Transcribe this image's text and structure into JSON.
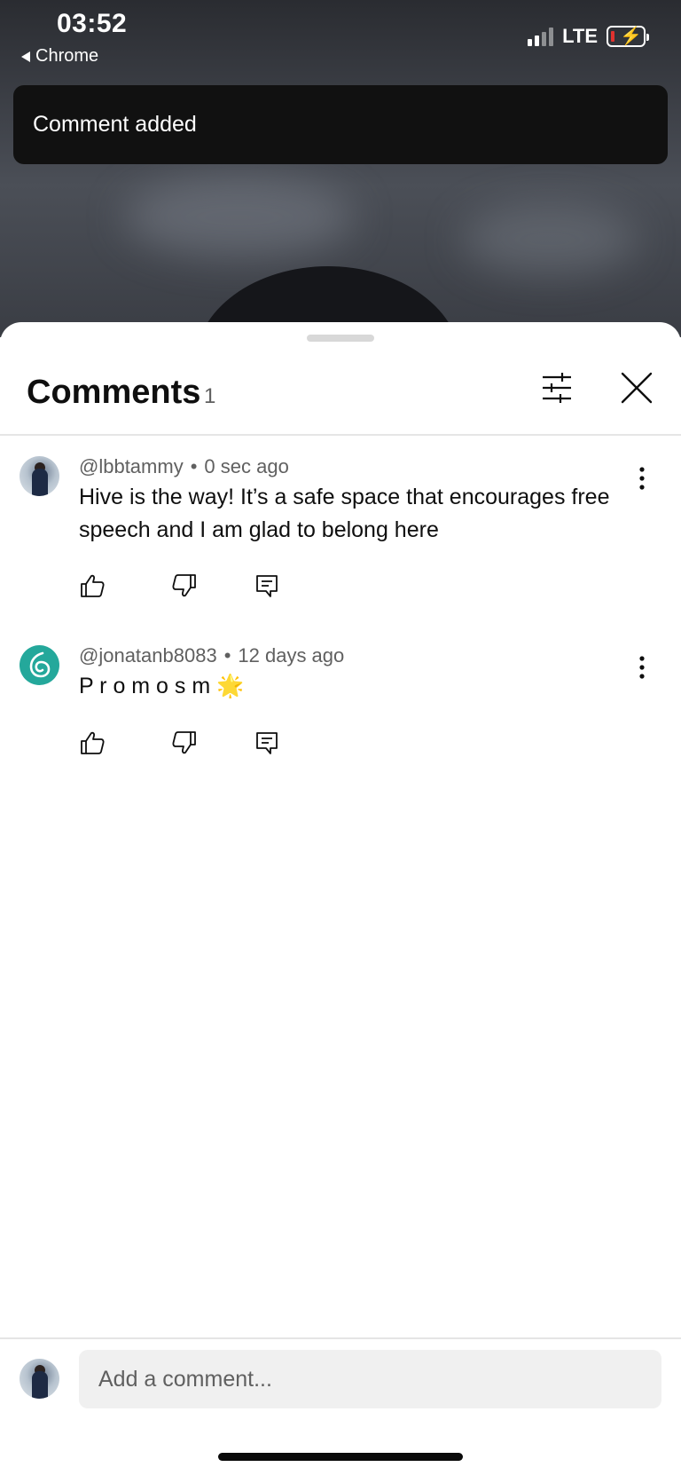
{
  "status_bar": {
    "time": "03:52",
    "back_app": "Chrome",
    "network": "LTE"
  },
  "toast": {
    "message": "Comment added"
  },
  "comments_panel": {
    "title": "Comments",
    "count": "1",
    "icons": {
      "filter": "sliders-icon",
      "close": "close-icon"
    }
  },
  "comments": [
    {
      "author": "@lbbtammy",
      "time": "0 sec ago",
      "text": "Hive is the way! It’s a safe space that encourages free speech and I am glad to belong here",
      "avatar": "user-photo-avatar"
    },
    {
      "author": "@jonatanb8083",
      "time": "12 days ago",
      "text": "P r o m o s m 🌟",
      "avatar": "teal-logo-avatar"
    }
  ],
  "separator": "•",
  "composer": {
    "placeholder": "Add a comment..."
  },
  "colors": {
    "toast_bg": "#111111",
    "text_primary": "#0f0f0f",
    "text_secondary": "#606060",
    "input_bg": "#f0f0f0",
    "teal_avatar": "#24a89b"
  }
}
